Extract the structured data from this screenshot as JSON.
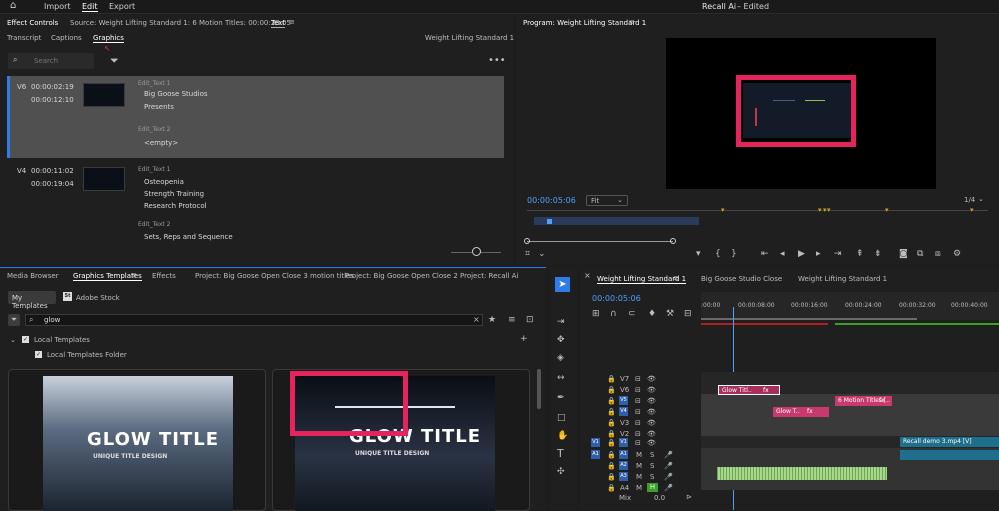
{
  "menu": {
    "home_icon": "home-icon",
    "import": "Import",
    "edit": "Edit",
    "export": "Export",
    "project_title": "Recall Ai",
    "edited": "– Edited"
  },
  "effect_controls": {
    "tab": "Effect Controls",
    "source": "Source: Weight Lifting Standard 1: 6 Motion Titles: 00:00:20:05",
    "text_tab": "Text",
    "subtabs": [
      "Transcript",
      "Captions",
      "Graphics"
    ],
    "sequence_name": "Weight Lifting Standard 1",
    "search_placeholder": "Search",
    "rows": [
      {
        "track": "V6",
        "in": "00:00:02:19",
        "out": "00:00:12:10",
        "label1": "Edit_Text 1",
        "lines1": [
          "Big Goose Studios",
          "Presents"
        ],
        "label2": "Edit_Text 2",
        "lines2": [
          "<empty>"
        ]
      },
      {
        "track": "V4",
        "in": "00:00:11:02",
        "out": "00:00:19:04",
        "label1": "Edit_Text 1",
        "lines1": [
          "Osteopenia",
          "Strength Training",
          "Research Protocol"
        ],
        "label2": "Edit_Text 2",
        "lines2": [
          "Sets, Reps and Sequence"
        ]
      }
    ]
  },
  "program": {
    "title": "Program: Weight Lifting Standard 1",
    "timecode": "00:00:05:06",
    "fit": "Fit",
    "fraction": "1/4"
  },
  "templates": {
    "tabs": [
      "Media Browser",
      "Graphics Templates",
      "Effects",
      "Project: Big Goose Open Close 3 motion titles",
      "Project: Big Goose Open Close 2",
      "Project: Recall Ai"
    ],
    "my_templates": "My Templates",
    "adobe_stock": "Adobe Stock",
    "search_value": "glow",
    "local_templates": "Local Templates",
    "local_folder": "Local Templates Folder",
    "cards": [
      {
        "title": "GLOW TITLE",
        "subtitle": "UNIQUE TITLE DESIGN"
      },
      {
        "title": "GLOW TITLE",
        "subtitle": "UNIQUE TITLE DESIGN"
      }
    ]
  },
  "timeline": {
    "tabs": [
      "Weight Lifting Standard 1",
      "Big Goose Studio Close",
      "Weight Lifting Standard 1"
    ],
    "timecode": "00:00:05:06",
    "ruler": [
      ":00:00",
      "00:00:08:00",
      "00:00:16:00",
      "00:00:24:00",
      "00:00:32:00",
      "00:00:40:00"
    ],
    "video_tracks": [
      "V7",
      "V6",
      "V5",
      "V4",
      "V3",
      "V2",
      "V1"
    ],
    "audio_tracks": [
      "A1",
      "A2",
      "A3",
      "A4"
    ],
    "mix": "Mix",
    "mix_value": "0.0",
    "source_v": "V1",
    "source_a": "A1",
    "clips": {
      "glow_v6": "Glow Titl..",
      "fx": "fx",
      "motion_v5": "6 Motion Titles [..",
      "glow_v4": "Glow T..",
      "recall_v1": "Recall demo 3.mp4 [V]"
    },
    "track_btns": {
      "m": "M",
      "s": "S"
    }
  },
  "colors": {
    "accent_blue": "#2f7be8",
    "pink_highlight": "#e5245e",
    "clip_pink": "#c83a6e",
    "clip_teal": "#1d6f8c",
    "audio_green": "#a8d98a"
  }
}
